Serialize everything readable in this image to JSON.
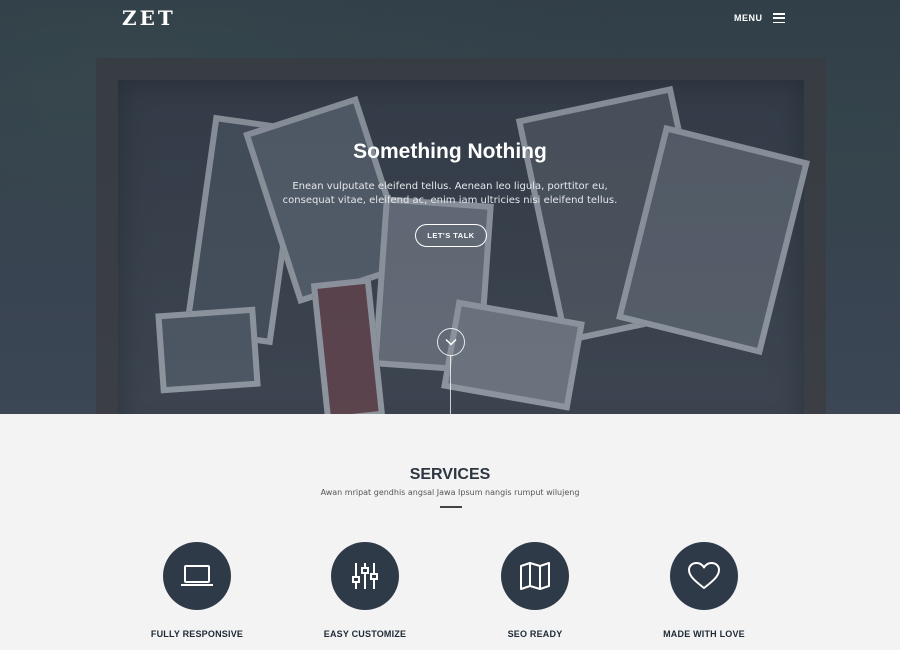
{
  "brand": {
    "logo": "ZET"
  },
  "nav": {
    "menu_label": "MENU"
  },
  "hero": {
    "title": "Something Nothing",
    "text": "Enean vulputate eleifend tellus. Aenean leo ligula, porttitor eu, consequat vitae, eleifend ac, enim iam ultricies nisi eleifend tellus.",
    "cta_label": "LET'S TALK"
  },
  "services": {
    "title": "SERVICES",
    "subtitle": "Awan mripat gendhis angsal Jawa Ipsum nangis rumput wilujeng",
    "items": [
      {
        "label": "FULLY RESPONSIVE",
        "icon": "laptop-icon"
      },
      {
        "label": "EASY CUSTOMIZE",
        "icon": "sliders-icon"
      },
      {
        "label": "SEO READY",
        "icon": "map-icon"
      },
      {
        "label": "MADE WITH LOVE",
        "icon": "heart-icon"
      }
    ]
  },
  "colors": {
    "accent_dark": "#2f3a48",
    "text_dark": "#1e2a35",
    "bg_light": "#f3f3f3"
  }
}
